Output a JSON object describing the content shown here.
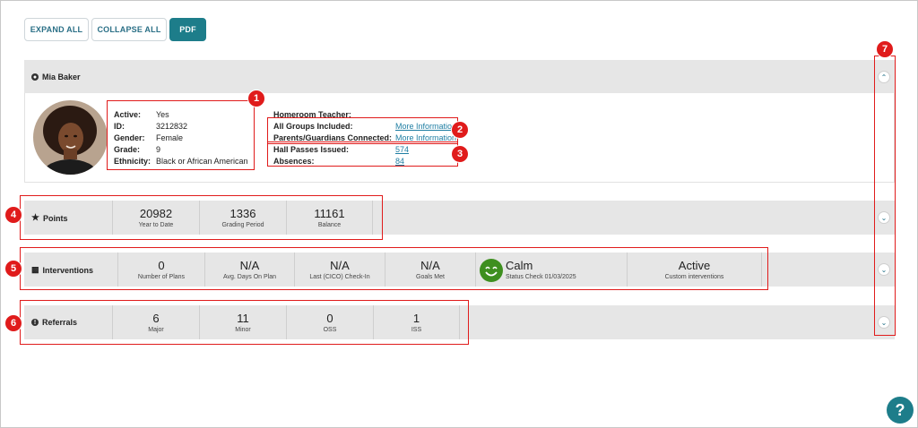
{
  "toolbar": {
    "expand_all": "EXPAND ALL",
    "collapse_all": "COLLAPSE ALL",
    "pdf": "PDF"
  },
  "student": {
    "name": "Mia Baker",
    "details": [
      {
        "label": "Active:",
        "value": "Yes"
      },
      {
        "label": "ID:",
        "value": "3212832"
      },
      {
        "label": "Gender:",
        "value": "Female"
      },
      {
        "label": "Grade:",
        "value": "9"
      },
      {
        "label": "Ethnicity:",
        "value": "Black or African American"
      }
    ],
    "extra": {
      "homeroom": "Homeroom Teacher:",
      "groups_label": "All Groups Included:",
      "groups_link": "More Information",
      "parents_label": "Parents/Guardians Connected:",
      "parents_link": "More Information",
      "hall_label": "Hall Passes Issued:",
      "hall_value": "574",
      "absences_label": "Absences:",
      "absences_value": "84"
    }
  },
  "points": {
    "title": "Points",
    "stats": [
      {
        "value": "20982",
        "label": "Year to Date"
      },
      {
        "value": "1336",
        "label": "Grading Period"
      },
      {
        "value": "11161",
        "label": "Balance"
      }
    ]
  },
  "interventions": {
    "title": "Interventions",
    "stats": [
      {
        "value": "0",
        "label": "Number of Plans"
      },
      {
        "value": "N/A",
        "label": "Avg. Days On Plan"
      },
      {
        "value": "N/A",
        "label": "Last (CICO) Check-In"
      },
      {
        "value": "N/A",
        "label": "Goals Met"
      }
    ],
    "status": {
      "value": "Calm",
      "label": "Status Check 01/03/2025"
    },
    "custom": {
      "value": "Active",
      "label": "Custom interventions"
    }
  },
  "referrals": {
    "title": "Referrals",
    "stats": [
      {
        "value": "6",
        "label": "Major"
      },
      {
        "value": "11",
        "label": "Minor"
      },
      {
        "value": "0",
        "label": "OSS"
      },
      {
        "value": "1",
        "label": "ISS"
      }
    ]
  },
  "annotations": [
    "1",
    "2",
    "3",
    "4",
    "5",
    "6",
    "7"
  ],
  "help": "?",
  "colors": {
    "accent": "#1d7d8a",
    "highlight": "#e01b1b",
    "band": "#e6e6e6",
    "calm": "#3e8f1f"
  },
  "icons": {
    "user": "user-circle-icon",
    "star": "star-icon",
    "chat": "chat-bubble-icon",
    "alert": "alert-circle-icon",
    "chevron": "chevron-icon"
  }
}
